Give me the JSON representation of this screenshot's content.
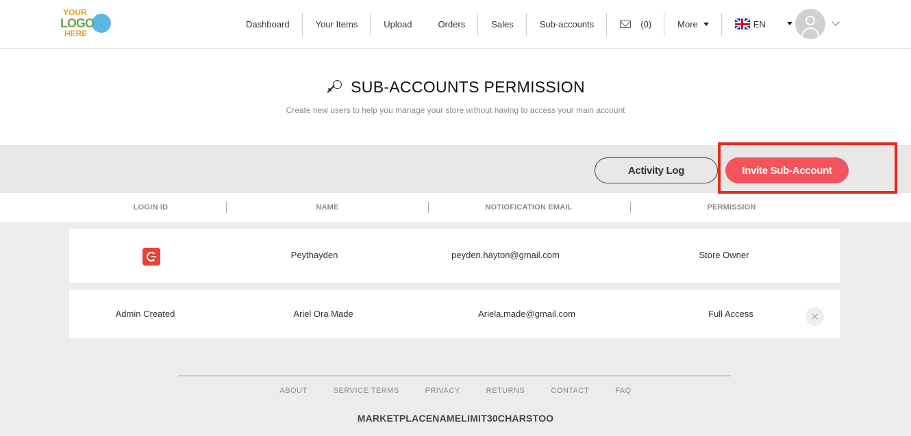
{
  "logo": {
    "line1": "YOUR",
    "line2": "LOGO",
    "line3": "HERE"
  },
  "nav": {
    "items": [
      {
        "label": "Dashboard"
      },
      {
        "label": "Your Items"
      },
      {
        "label": "Upload"
      },
      {
        "label": "Orders"
      },
      {
        "label": "Sales"
      },
      {
        "label": "Sub-accounts"
      }
    ],
    "messages_count": "(0)",
    "more_label": "More",
    "language": "EN"
  },
  "page": {
    "title": "SUB-ACCOUNTS PERMISSION",
    "subtitle": "Create new users to help you manage your store without having to access your main account"
  },
  "actions": {
    "activity_log": "Activity Log",
    "invite": "Invite Sub-Account"
  },
  "table": {
    "headers": [
      "LOGIN ID",
      "NAME",
      "NOTIOFICATION EMAIL",
      "PERMISSION"
    ],
    "rows": [
      {
        "login_id": "",
        "login_icon": "google-icon",
        "name": "Peythayden",
        "email": "peyden.hayton@gmail.com",
        "permission": "Store Owner"
      },
      {
        "login_id": "Admin Created",
        "name": "Ariel Ora Made",
        "email": "Ariela.made@gmail.com",
        "permission": "Full Access"
      }
    ]
  },
  "footer": {
    "links": [
      "ABOUT",
      "SERVICE TERMS",
      "PRIVACY",
      "RETURNS",
      "CONTACT",
      "FAQ"
    ],
    "brand": "MARKETPLACENAMELIMIT30CHARSTOO"
  },
  "colors": {
    "accent": "#f2545b",
    "highlight": "#e8281e",
    "band": "#e8e8e8"
  }
}
